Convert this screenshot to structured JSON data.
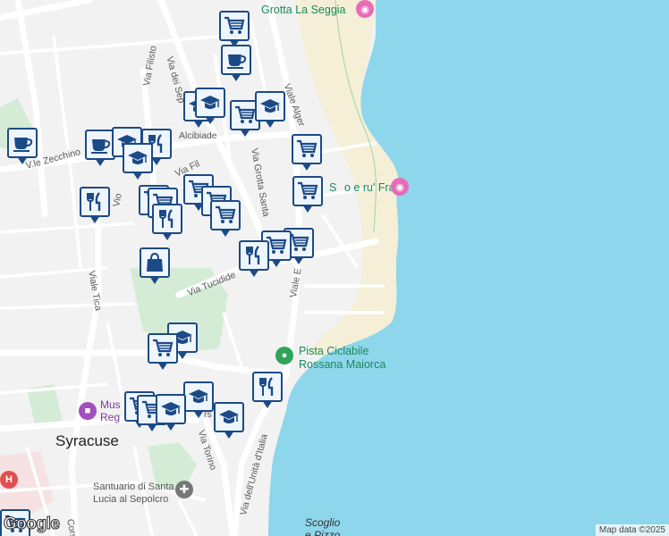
{
  "map": {
    "colors": {
      "sea": "#8ed6ec",
      "land": "#f2f2f2",
      "beach": "#f5efd8",
      "park": "#d4ecd6",
      "road": "#ffffff",
      "marker_border": "#1c4a86",
      "marker_fill": "#eef5fd"
    },
    "labels": {
      "grotta": "Grotta La Seggia",
      "frati": "S… o e ru' Frati",
      "frati_a": "S",
      "frati_b": "o e ru' Frati",
      "pista1": "Pista Ciclabile",
      "pista2": "Rossana Maiorca",
      "city": "Syracuse",
      "santuario1": "Santuario di Santa",
      "santuario2": "Lucia al Sepolcro",
      "museo1": "Mus",
      "museo2": "Reg",
      "scoglio1": "Scoglio",
      "scoglio2": "e Pizzo"
    },
    "roads": {
      "via_dei_sep": "Via dei Sep",
      "via_filisto": "Via Filisto",
      "alcibiade": "Alcibiade",
      "via_fil": "Via Fil",
      "le_zecchino": "V.le Zecchino",
      "vio": "Vio",
      "viale_tica": "Viale Tica",
      "via_grotta_santa": "Via Grotta Santa",
      "viale_alger": "Viale Alger",
      "via_tucidide": "Via Tucidide",
      "viale_e": "Viale E",
      "via_torino": "Via Torino",
      "via_unita": "Via dell'Unità d'Italia",
      "cors": "Cors",
      "rs": "rs"
    },
    "markers": [
      {
        "icon": "shopping-cart",
        "name": "marker-shopping-cart"
      },
      {
        "icon": "coffee",
        "name": "marker-coffee"
      },
      {
        "icon": "graduation-cap",
        "name": "marker-school"
      },
      {
        "icon": "restaurant",
        "name": "marker-restaurant"
      },
      {
        "icon": "shopping-bag",
        "name": "marker-shopping-bag"
      }
    ],
    "attribution": "Map data ©2025",
    "logo": "Google"
  }
}
